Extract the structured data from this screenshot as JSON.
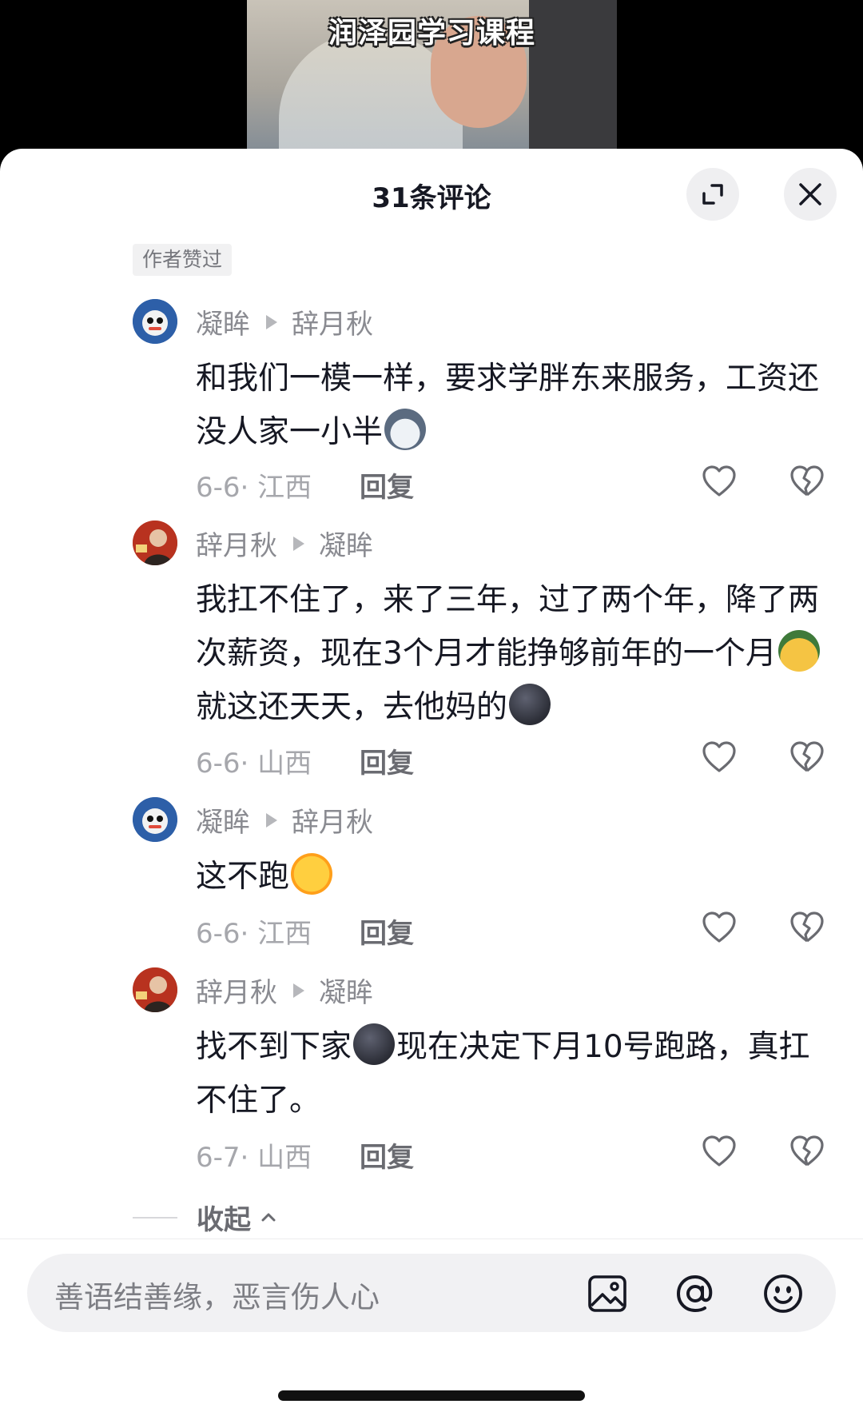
{
  "video": {
    "caption": "润泽园学习课程"
  },
  "header": {
    "title": "31条评论"
  },
  "badge": {
    "author_liked": "作者赞过"
  },
  "comments": [
    {
      "user": "凝眸",
      "reply_to": "辞月秋",
      "text_parts": [
        "和我们一模一样，要求学胖东来服务，工资还没人家一小半",
        ""
      ],
      "date": "6-6",
      "location": "江西",
      "reply_label": "回复"
    },
    {
      "user": "辞月秋",
      "reply_to": "凝眸",
      "text_parts": [
        "我扛不住了，来了三年，过了两个年，降了两次薪资，现在3个月才能挣够前年的一个月",
        "就这还天天，去他妈的",
        ""
      ],
      "date": "6-6",
      "location": "山西",
      "reply_label": "回复"
    },
    {
      "user": "凝眸",
      "reply_to": "辞月秋",
      "text_parts": [
        "这不跑",
        ""
      ],
      "date": "6-6",
      "location": "江西",
      "reply_label": "回复"
    },
    {
      "user": "辞月秋",
      "reply_to": "凝眸",
      "text_parts": [
        "找不到下家",
        "现在决定下月10号跑路，真扛不住了。"
      ],
      "date": "6-7",
      "location": "山西",
      "reply_label": "回复"
    }
  ],
  "collapse": {
    "label": "收起"
  },
  "input": {
    "placeholder": "善语结善缘，恶言伤人心"
  }
}
